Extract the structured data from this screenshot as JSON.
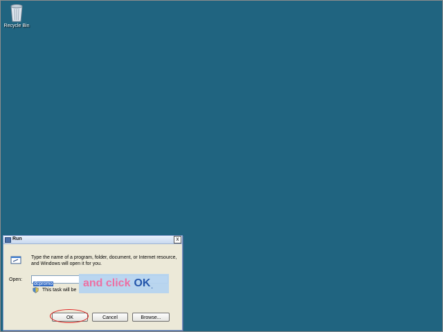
{
  "desktop": {
    "icons": [
      {
        "label": "Recycle Bin",
        "icon": "recycle-bin-icon"
      }
    ]
  },
  "run_dialog": {
    "title": "Run",
    "close_label": "x",
    "instruction": "Type the name of a program, folder, document, or Internet resource, and Windows will open it for you.",
    "open_label": "Open:",
    "open_value": "dcpromo",
    "admin_note": "This task will be",
    "buttons": {
      "ok": "OK",
      "cancel": "Cancel",
      "browse": "Browse..."
    }
  },
  "tutorial": {
    "callout_text": "and click",
    "callout_emphasis": "OK",
    "callout_suffix": "."
  },
  "colors": {
    "desktop_background": "#206480",
    "highlight_ring": "#e02020",
    "callout_background": "#b7d4f0"
  }
}
